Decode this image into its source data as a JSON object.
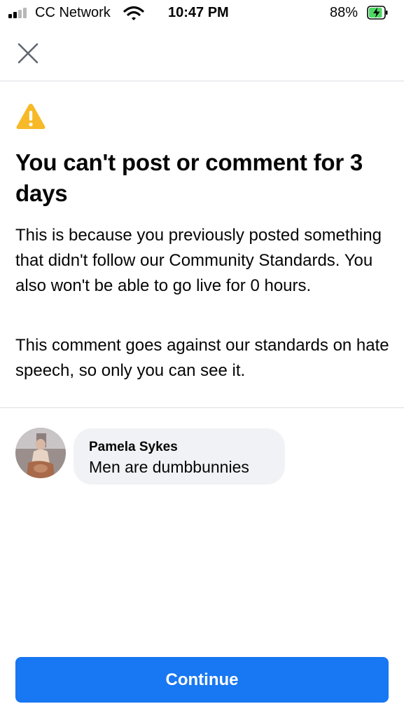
{
  "status_bar": {
    "carrier": "CC Network",
    "time": "10:47 PM",
    "battery_percent": "88%",
    "signal_bars_filled": 2,
    "signal_bars_total": 4,
    "battery_level": 0.88,
    "charging": true,
    "icons": [
      "signal-icon",
      "wifi-icon",
      "battery-charging-icon"
    ]
  },
  "header": {
    "close_icon": "close-icon"
  },
  "notice": {
    "icon": "warning-icon",
    "title": "You can't post or comment for 3 days",
    "body": "This is because you previously posted something that didn't follow our Community Standards. You also won't be able to go live for 0 hours.",
    "detail": "This comment goes against our standards on hate speech, so only you can see it."
  },
  "comment": {
    "author": "Pamela Sykes",
    "text": "Men are dumbbunnies"
  },
  "actions": {
    "continue_label": "Continue"
  },
  "colors": {
    "accent": "#1877f2",
    "warning": "#f7b928",
    "bubble": "#f0f2f5",
    "battery_charge": "#4cd964",
    "divider": "#dcdde1"
  }
}
